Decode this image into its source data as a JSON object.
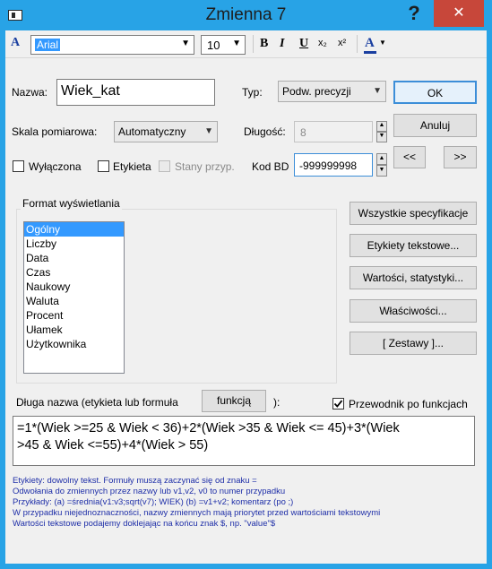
{
  "window": {
    "title": "Zmienna 7",
    "help": "?",
    "close": "✕"
  },
  "toolbar": {
    "font_name": "Arial",
    "font_size": "10",
    "bold": "B",
    "italic": "I",
    "underline": "U",
    "subscript": "x₂",
    "superscript": "x²",
    "font_color": "A"
  },
  "form": {
    "name_label": "Nazwa:",
    "name_value": "Wiek_kat",
    "type_label": "Typ:",
    "type_value": "Podw. precyzji",
    "scale_label": "Skala pomiarowa:",
    "scale_value": "Automatyczny",
    "length_label": "Długość:",
    "length_value": "8",
    "excluded_label": "Wyłączona",
    "label_label": "Etykieta",
    "states_label": "Stany przyp.",
    "md_code_label": "Kod BD",
    "md_code_value": "-999999998"
  },
  "buttons": {
    "ok": "OK",
    "cancel": "Anuluj",
    "prev": "<<",
    "next": ">>",
    "all_specs": "Wszystkie specyfikacje",
    "text_labels": "Etykiety tekstowe...",
    "values_stats": "Wartości, statystyki...",
    "properties": "Właściwości...",
    "sets": "[ Zestawy ]..."
  },
  "display_format": {
    "title": "Format wyświetlania",
    "items": [
      "Ogólny",
      "Liczby",
      "Data",
      "Czas",
      "Naukowy",
      "Waluta",
      "Procent",
      "Ułamek",
      "Użytkownika"
    ],
    "selected": "Ogólny"
  },
  "long_name": {
    "label": "Długa nazwa (etykieta lub formuła",
    "function_button": "funkcją",
    "suffix": "):",
    "wizard_label": "Przewodnik po funkcjach",
    "wizard_checked": true,
    "formula_line1": "=1*(Wiek >=25 & Wiek < 36)+2*(Wiek >35 & Wiek <= 45)+3*(Wiek",
    "formula_line2": ">45 & Wiek <=55)+4*(Wiek > 55)"
  },
  "help": {
    "line1": "Etykiety:  dowolny tekst. Formuły muszą zaczynać się od znaku =",
    "line2": "Odwołania do zmiennych przez nazwy lub v1,v2, v0 to numer przypadku",
    "line3": "Przykłady: (a) =średnia(v1:v3;sqrt(v7); WIEK) (b) =v1+v2; komentarz (po ;)",
    "line4": "W przypadku niejednoznaczności, nazwy zmiennych mają priorytet przed wartościami tekstowymi",
    "line5": "Wartości tekstowe podajemy doklejając na końcu znak $, np. \"value\"$"
  },
  "colors": {
    "titlebar": "#28a3e6",
    "close": "#c7473a",
    "help_text": "#1f2fa8",
    "selection": "#3399ff"
  }
}
